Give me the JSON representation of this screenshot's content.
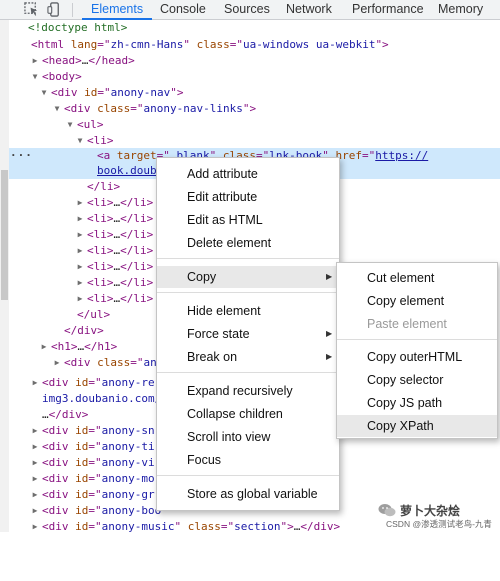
{
  "toolbar": {
    "tabs": [
      "Elements",
      "Console",
      "Sources",
      "Network",
      "Performance",
      "Memory"
    ],
    "active_tab": "Elements"
  },
  "dom": {
    "doctype": "<!doctype html>",
    "html_lang": "zh-cmn-Hans",
    "html_class": "ua-windows ua-webkit",
    "nav_id": "anony-nav",
    "nav_links_class": "anony-nav-links",
    "a_target": "_blank",
    "a_class": "lnk-book",
    "a_href": "https://",
    "a_cont": "book.doub",
    "li_count": 7,
    "h1_text": "…",
    "div_anon_class_prefix": "ano",
    "div_re_id_prefix": "anony-re",
    "img_text": "img3.doubanio.com/",
    "rows_left": [
      "anony-sn",
      "anony-ti",
      "anony-vi",
      "anony-mo",
      "anony-gr",
      "anony-boo"
    ],
    "music_id": "anony-music",
    "music_class": "section"
  },
  "context_menu": {
    "items": [
      "Add attribute",
      "Edit attribute",
      "Edit as HTML",
      "Delete element",
      "Copy",
      "Hide element",
      "Force state",
      "Break on",
      "Expand recursively",
      "Collapse children",
      "Scroll into view",
      "Focus",
      "Store as global variable"
    ],
    "selected": "Copy"
  },
  "copy_submenu": {
    "items": [
      "Cut element",
      "Copy element",
      "Paste element",
      "Copy outerHTML",
      "Copy selector",
      "Copy JS path",
      "Copy XPath"
    ],
    "disabled": [
      "Paste element"
    ],
    "selected": "Copy XPath"
  },
  "watermark": {
    "name": "萝卜大杂烩",
    "sub": "CSDN @渗透测试老鸟-九青"
  },
  "colors": {
    "accent": "#1a73e8",
    "tag": "#881280",
    "attr_name": "#994500",
    "attr_value": "#1a1aa6"
  }
}
